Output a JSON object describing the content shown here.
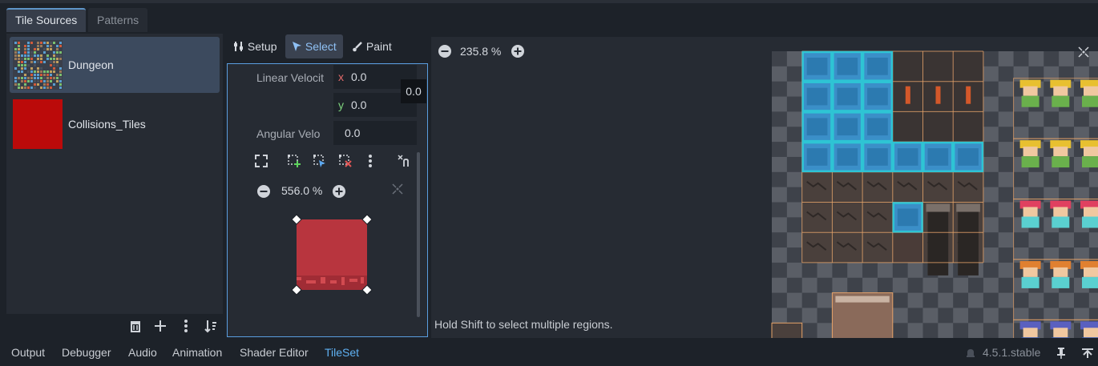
{
  "top_tabs": {
    "tile_sources": "Tile Sources",
    "patterns": "Patterns"
  },
  "sources": [
    {
      "name": "Dungeon",
      "selected": true
    },
    {
      "name": "Collisions_Tiles",
      "selected": false,
      "color": "#bb0a0a"
    }
  ],
  "source_toolbar": {
    "icons": [
      "trash-icon",
      "plus-icon",
      "kebab-menu-icon",
      "sort-icon"
    ]
  },
  "modes": {
    "setup": "Setup",
    "select": "Select",
    "paint": "Paint"
  },
  "inspector": {
    "linear_velocity_label": "Linear Velocit",
    "x_axis": "x",
    "x_value": "0.0",
    "y_axis": "y",
    "y_value": "0.0",
    "tooltip_value": "0.0",
    "angular_velocity_label": "Angular Velo",
    "angular_value": "0.0",
    "poly_zoom": "556.0 %"
  },
  "atlas": {
    "zoom": "235.8 %"
  },
  "hint": "Hold Shift to select multiple regions.",
  "bottom_tabs": [
    "Output",
    "Debugger",
    "Audio",
    "Animation",
    "Shader Editor",
    "TileSet"
  ],
  "version": "4.5.1.stable",
  "colors": {
    "accent": "#5fb1f3",
    "selection": "#2ec4d4",
    "tile_grid": "#e7a46a",
    "collision": "#b8353e"
  }
}
